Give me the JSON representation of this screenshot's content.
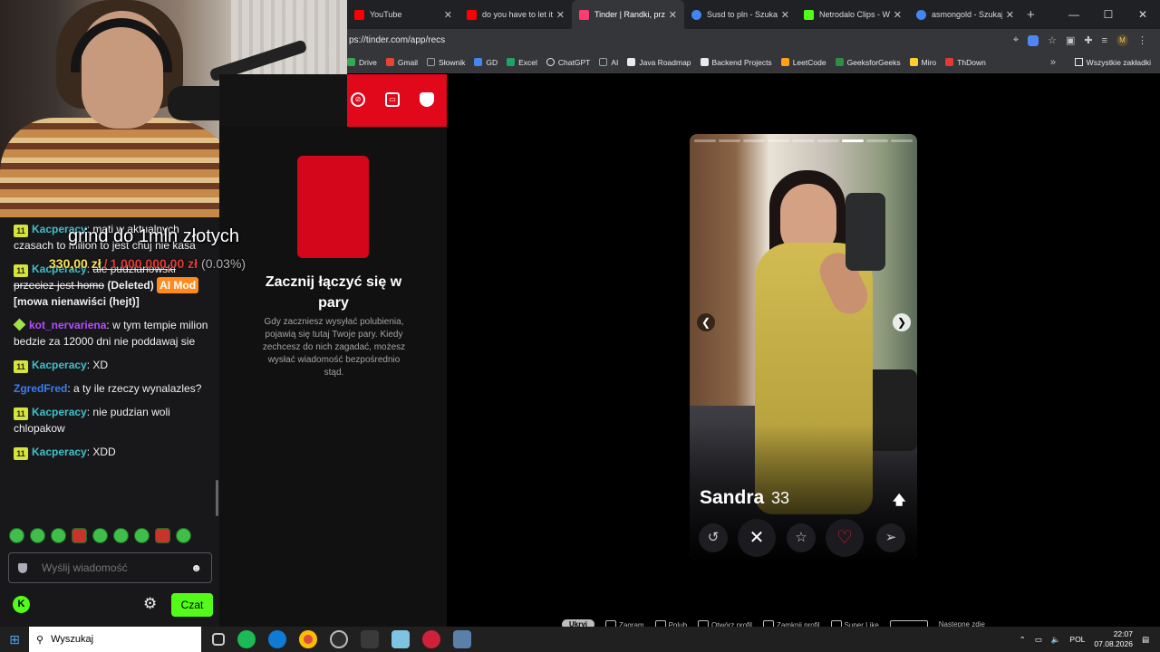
{
  "browser": {
    "tabs": [
      {
        "label": "YouTube",
        "color": "#ff0000"
      },
      {
        "label": "do you have to let it",
        "color": "#ff0000"
      },
      {
        "label": "Tinder | Randki, przyj",
        "color": "#fe3c72",
        "active": true
      },
      {
        "label": "Susd to pln - Szukaj",
        "color": "#4285f4"
      },
      {
        "label": "Netrodalo Clips - Wa",
        "color": "#53fc18"
      },
      {
        "label": "asmongold - Szukaj",
        "color": "#4285f4"
      }
    ],
    "url": "ps://tinder.com/app/recs",
    "bookmarks": [
      {
        "label": "Drive",
        "color": "#34a853"
      },
      {
        "label": "Gmail",
        "color": "#ea4335"
      },
      {
        "label": "Słownik",
        "color": "#9aa0a6"
      },
      {
        "label": "GD",
        "color": "#4285f4"
      },
      {
        "label": "Excel",
        "color": "#21a366"
      },
      {
        "label": "ChatGPT",
        "color": "#e8eaed"
      },
      {
        "label": "AI",
        "color": "#9aa0a6"
      },
      {
        "label": "Java Roadmap",
        "color": "#e8eaed"
      },
      {
        "label": "Backend Projects",
        "color": "#e8eaed"
      },
      {
        "label": "LeetCode",
        "color": "#ffa116"
      },
      {
        "label": "GeeksforGeeks",
        "color": "#2f8d46"
      },
      {
        "label": "Miro",
        "color": "#ffd02f"
      },
      {
        "label": "ThDown",
        "color": "#e53935"
      }
    ],
    "all_bookmarks": "Wszystkie zakładki"
  },
  "overlay": {
    "title": "grind do 1mln złotych",
    "current": "330,00 zł",
    "separator": "/",
    "target": "1 000 000,00 zł",
    "percent": "(0.03%)",
    "progress_fraction": 0.0003
  },
  "chat": {
    "messages": [
      {
        "badge": "11",
        "user": "Kacperacy",
        "text": "mati w aktualnych czasach to milion to jest chuj nie kasa"
      },
      {
        "badge": "11",
        "user": "Kacperacy",
        "deleted_text": "ale pudzianowski przeciez jest homo",
        "deleted_label": "(Deleted)",
        "mod_label": "AI Mod",
        "reason": "[mowa nienawiści (hejt)]"
      },
      {
        "user": "kot_nervariena",
        "text": "w tym tempie milion bedzie za 12000 dni nie poddawaj sie"
      },
      {
        "badge": "11",
        "user": "Kacperacy",
        "text": "XD"
      },
      {
        "user": "ZgredFred",
        "text": "a ty ile rzeczy wynalazles?"
      },
      {
        "badge": "11",
        "user": "Kacperacy",
        "text": "nie pudzian woli chlopakow"
      },
      {
        "badge": "11",
        "user": "Kacperacy",
        "text": "XDD"
      }
    ],
    "input_placeholder": "Wyślij wiadomość",
    "send_button": "Czat"
  },
  "tinder": {
    "empty_title": "Zacznij łączyć się w pary",
    "empty_desc": "Gdy zaczniesz wysyłać polubienia, pojawią się tutaj Twoje pary. Kiedy zechcesz do nich zagadać, możesz wysłać wiadomość bezpośrednio stąd.",
    "profile": {
      "name": "Sandra",
      "age": "33",
      "photo_count": 9,
      "current_photo": 7
    }
  },
  "shortcuts": [
    "Ukryj",
    "Zagram",
    "Polub",
    "Otwórz profil",
    "Zamknij profil",
    "Super Like",
    "Następne zdję"
  ],
  "taskbar": {
    "search": "Wyszukaj",
    "lang": "POL",
    "time": "22:07",
    "date": "07.08.2026"
  }
}
